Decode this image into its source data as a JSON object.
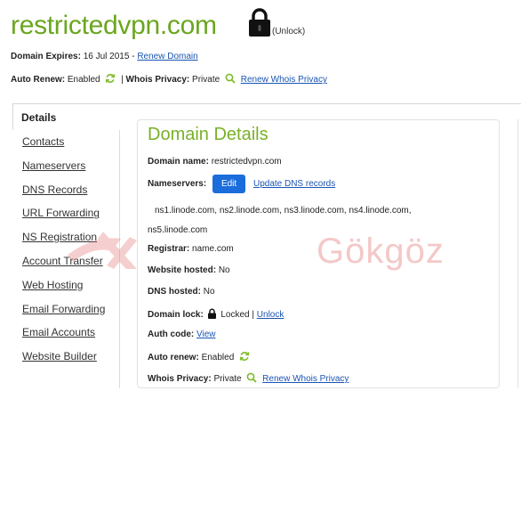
{
  "header": {
    "domain": "restrictedvpn.com",
    "unlock_label": "(Unlock)",
    "expires_label": "Domain Expires:",
    "expires_date": "16 Jul 2015 -",
    "renew_domain": "Renew Domain",
    "auto_renew_label": "Auto Renew:",
    "auto_renew_value": "Enabled",
    "separator": "|",
    "whois_label": "Whois Privacy:",
    "whois_value": "Private",
    "renew_whois": "Renew Whois Privacy"
  },
  "sidebar": {
    "active_tab": "Details",
    "items": [
      {
        "label": "Contacts"
      },
      {
        "label": "Nameservers"
      },
      {
        "label": "DNS Records"
      },
      {
        "label": "URL Forwarding"
      },
      {
        "label": "NS Registration"
      },
      {
        "label": "Account Transfer"
      },
      {
        "label": "Web Hosting"
      },
      {
        "label": "Email Forwarding"
      },
      {
        "label": "Email Accounts"
      },
      {
        "label": "Website Builder"
      }
    ]
  },
  "details": {
    "title": "Domain Details",
    "domain_name_label": "Domain name:",
    "domain_name_value": "restrictedvpn.com",
    "nameservers_label": "Nameservers:",
    "edit_button": "Edit",
    "update_dns_link": "Update DNS records",
    "nameservers_list": "ns1.linode.com, ns2.linode.com, ns3.linode.com, ns4.linode.com,",
    "nameservers_list_2": "ns5.linode.com",
    "registrar_label": "Registrar:",
    "registrar_value": "name.com",
    "website_hosted_label": "Website hosted:",
    "website_hosted_value": "No",
    "dns_hosted_label": "DNS hosted:",
    "dns_hosted_value": "No",
    "domain_lock_label": "Domain lock:",
    "domain_lock_value": "Locked",
    "separator": "|",
    "unlock_link": "Unlock",
    "auth_code_label": "Auth code:",
    "auth_code_link": "View",
    "auto_renew_label": "Auto renew:",
    "auto_renew_value": "Enabled",
    "whois_label": "Whois Privacy:",
    "whois_value": "Private",
    "renew_whois_link": "Renew Whois Privacy"
  },
  "watermark": {
    "text": "Gökgöz"
  },
  "colors": {
    "brand_green": "#6aa61e",
    "link_blue": "#1a55b3",
    "button_blue": "#1b6ddb"
  }
}
